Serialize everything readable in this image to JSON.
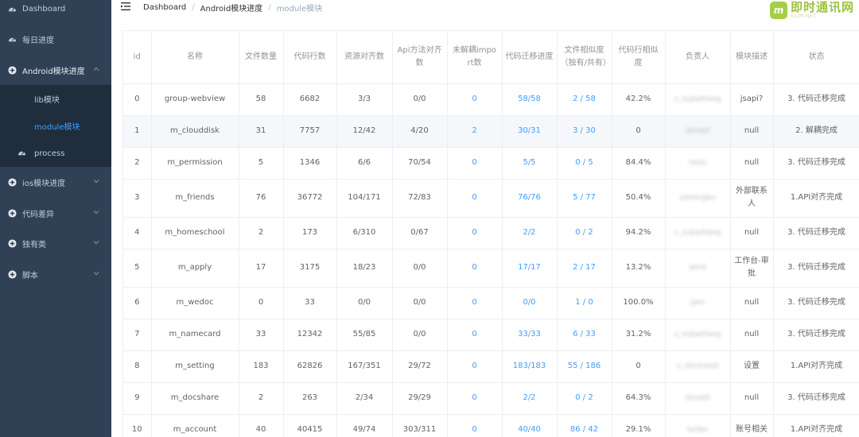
{
  "sidebar": {
    "items": [
      {
        "label": "Dashboard",
        "icon": "dashboard-icon"
      },
      {
        "label": "每日进度",
        "icon": "dashboard-icon"
      },
      {
        "label": "Android模块进度",
        "icon": "plus-circle-icon"
      },
      {
        "label": "ios模块进度",
        "icon": "plus-circle-icon"
      },
      {
        "label": "代码差异",
        "icon": "plus-circle-icon"
      },
      {
        "label": "独有类",
        "icon": "plus-circle-icon"
      },
      {
        "label": "脚本",
        "icon": "plus-circle-icon"
      }
    ],
    "submenu": [
      {
        "label": "lib模块"
      },
      {
        "label": "module模块"
      },
      {
        "label": "process"
      }
    ],
    "active_color": "#409eff",
    "bg_color": "#304156"
  },
  "breadcrumb": [
    "Dashboard",
    "Android模块进度",
    "module模块"
  ],
  "logo": {
    "text": "即时通讯网",
    "sub": "52IM.NET"
  },
  "table": {
    "headers": [
      "id",
      "名称",
      "文件数量",
      "代码行数",
      "资源对齐数",
      "Api方法对齐数",
      "未解耦impo rt数",
      "代码迁移进度",
      "文件相似度 （独有/共有）",
      "代码行相似度",
      "负责人",
      "模块描述",
      "状态"
    ],
    "rows": [
      [
        "0",
        "group-webview",
        "58",
        "6682",
        "3/3",
        "0/0",
        "0",
        "58/58",
        "2 / 58",
        "42.2%",
        "v_xujiazhang",
        "jsapi?",
        "3. 代码迁移完成"
      ],
      [
        "1",
        "m_clouddisk",
        "31",
        "7757",
        "12/42",
        "4/20",
        "2",
        "30/31",
        "3 / 30",
        "0",
        "donald",
        "null",
        "2. 解耦完成"
      ],
      [
        "2",
        "m_permission",
        "5",
        "1346",
        "6/6",
        "70/54",
        "0",
        "5/5",
        "0 / 5",
        "84.4%",
        "nooo",
        "null",
        "3. 代码迁移完成"
      ],
      [
        "3",
        "m_friends",
        "76",
        "36772",
        "104/171",
        "72/83",
        "0",
        "76/76",
        "5 / 77",
        "50.4%",
        "yeeongbu",
        "外部联系人",
        "1.API对齐完成"
      ],
      [
        "4",
        "m_homeschool",
        "2",
        "173",
        "6/310",
        "0/67",
        "0",
        "2/2",
        "0 / 2",
        "94.2%",
        "v_xujiazhang",
        "null",
        "3. 代码迁移完成"
      ],
      [
        "5",
        "m_apply",
        "17",
        "3175",
        "18/23",
        "0/0",
        "0",
        "17/17",
        "2 / 17",
        "13.2%",
        "wind",
        "工作台-审批",
        "3. 代码迁移完成"
      ],
      [
        "6",
        "m_wedoc",
        "0",
        "33",
        "0/0",
        "0/0",
        "0",
        "0/0",
        "1 / 0",
        "100.0%",
        "jiaxi",
        "null",
        "3. 代码迁移完成"
      ],
      [
        "7",
        "m_namecard",
        "33",
        "12342",
        "55/85",
        "0/0",
        "0",
        "33/33",
        "6 / 33",
        "31.2%",
        "v_xujiazhang",
        "null",
        "3. 代码迁移完成"
      ],
      [
        "8",
        "m_setting",
        "183",
        "62826",
        "167/351",
        "29/72",
        "0",
        "183/183",
        "55 / 186",
        "0",
        "v_zhichaodi",
        "设置",
        "1.API对齐完成"
      ],
      [
        "9",
        "m_docshare",
        "2",
        "263",
        "2/34",
        "29/29",
        "0",
        "2/2",
        "0 / 2",
        "64.3%",
        "donald",
        "null",
        "3. 代码迁移完成"
      ],
      [
        "10",
        "m_account",
        "40",
        "40415",
        "49/74",
        "303/311",
        "0",
        "40/40",
        "86 / 42",
        "29.1%",
        "locker",
        "账号相关",
        "1.API对齐完成"
      ]
    ]
  }
}
